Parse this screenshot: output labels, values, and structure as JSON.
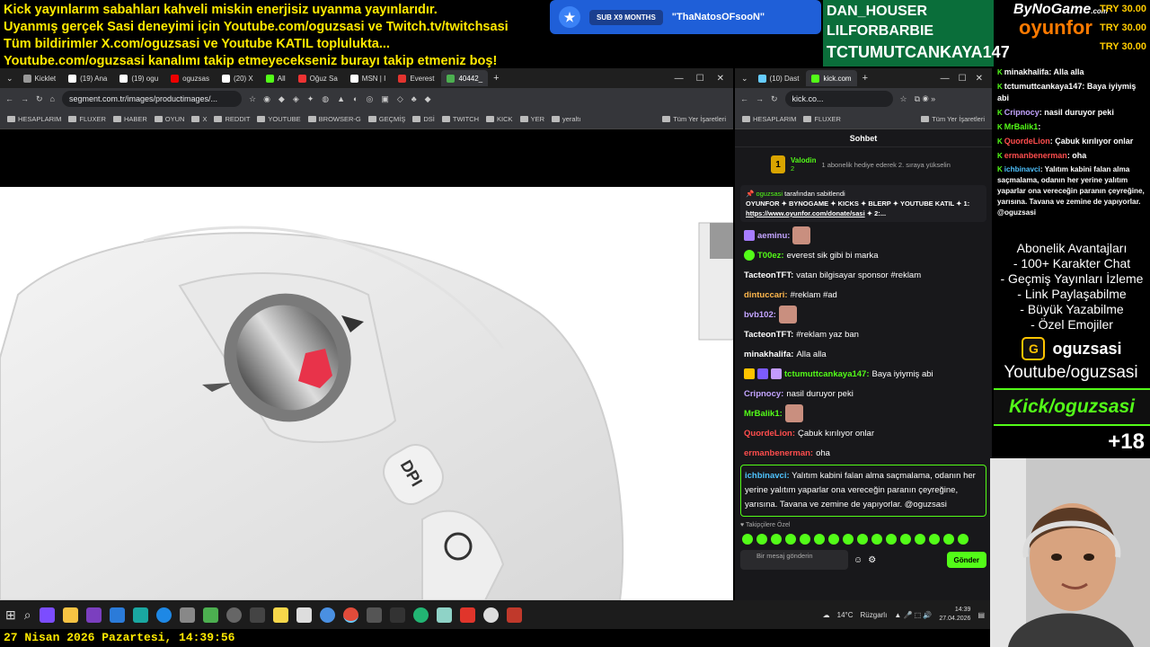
{
  "ticker": {
    "line1": "Kick yayınlarım sabahları kahveli miskin enerjisiz uyanma yayınlarıdır.",
    "line2": "Uyanmış gerçek Sasi deneyimi için Youtube.com/oguzsasi ve Twitch.tv/twitchsasi",
    "line3": "Tüm bildirimler X.com/oguzsasi ve Youtube KATIL toplulukta...",
    "line4": "Youtube.com/oguzsasi kanalımı takip etmeyecekseniz burayı takip etmeniz boş!"
  },
  "sub_alert": {
    "pill": "SUB X9 MONTHS",
    "name": "\"ThaNatosOFsooN\""
  },
  "top_donors": [
    "DAN_HOUSER",
    "LILFORBARBIE",
    "TCTUMUTCANKAYA147"
  ],
  "brand": {
    "top": "ByNoGame",
    "bottom": "oyunfor",
    "com": ".com"
  },
  "tries": [
    "TRY 30.00",
    "TRY 30.00",
    "TRY 30.00"
  ],
  "left_browser": {
    "tabs": [
      "Kicklet",
      "(19) Ana",
      "(19) ogu",
      "oguzsas",
      "(20) X",
      "All",
      "Oğuz Sa",
      "MSN | I",
      "Everest",
      "40442_"
    ],
    "url": "segment.com.tr/images/productimages/...",
    "bookmarks": [
      "HESAPLARIM",
      "FLUXER",
      "HABER",
      "OYUN",
      "X",
      "REDDIT",
      "YOUTUBE",
      "BROWSER-G",
      "GEÇMİŞ",
      "DSİ",
      "TWITCH",
      "KICK",
      "YER",
      "yeraltı",
      "Tüm Yer İşaretleri"
    ],
    "dpi_label": "DPI"
  },
  "right_browser": {
    "tabs": [
      "(10) Dast",
      "kick.com"
    ],
    "url": "kick.co...",
    "bookmarks": [
      "HESAPLARIM",
      "FLUXER",
      "Tüm Yer İşaretleri"
    ],
    "chat_title": "Sohbet",
    "gift_user": "Valodin",
    "gift_count": "2",
    "gift_badge": "1",
    "gift_text": "1 abonelik hediye ederek 2. sıraya yükselin",
    "pinned_by_user": "oguzsasi",
    "pinned_by_text": "tarafından sabitlendi",
    "pinned_text": "OYUNFOR ✦ BYNOGAME ✦ KICKS ✦ BLERP ✦ YOUTUBE KATIL ✦ 1:",
    "pinned_link": "https://www.oyunfor.com/donate/sasi",
    "pinned_suffix": "✦ 2:...",
    "messages": [
      {
        "user": "aeminu:",
        "color": "#c3a4ff",
        "text": ""
      },
      {
        "user": "T00ez:",
        "color": "#53fc18",
        "text": "everest sik gibi bi marka"
      },
      {
        "user": "TacteonTFT:",
        "color": "#ffffff",
        "text": "vatan bilgisayar sponsor #reklam"
      },
      {
        "user": "dintuccari:",
        "color": "#ffb84d",
        "text": "#reklam #ad"
      },
      {
        "user": "bvb102:",
        "color": "#c3a4ff",
        "text": ""
      },
      {
        "user": "TacteonTFT:",
        "color": "#ffffff",
        "text": "#reklam yaz ban"
      },
      {
        "user": "minakhalifa:",
        "color": "#ffffff",
        "text": "Alla alla"
      },
      {
        "user": "tctumuttcankaya147:",
        "color": "#53fc18",
        "text": "Baya iyiymiş abi"
      },
      {
        "user": "Cripnocy:",
        "color": "#c3a4ff",
        "text": "nasil duruyor peki"
      },
      {
        "user": "MrBalik1:",
        "color": "#53fc18",
        "text": ""
      },
      {
        "user": "QuordeLion:",
        "color": "#ff4d4d",
        "text": "Çabuk kırılıyor onlar"
      },
      {
        "user": "ermanbenerman:",
        "color": "#ff4d4d",
        "text": "oha"
      }
    ],
    "highlight_user": "ichbinavci:",
    "highlight_text": "Yalıtım kabini falan alma saçmalama, odanın her yerine yalıtım yaparlar ona vereceğin paranın çeyreğine, yarısına. Tavana ve zemine de yapıyorlar. @oguzsasi",
    "followers_label": "Takipçilere Özel",
    "input_placeholder": "Bir mesaj gönderin",
    "send_label": "Gönder"
  },
  "overlay_chat": [
    {
      "user": "minakhalifa",
      "text": ": Alla alla"
    },
    {
      "user": "tctumuttcankaya147",
      "text": ": Baya iyiymiş abi"
    },
    {
      "user": "Cripnocy",
      "text": ": nasil duruyor peki"
    },
    {
      "user": "MrBalik1",
      "text": ":"
    },
    {
      "user": "QuordeLion",
      "text": ": Çabuk kırılıyor onlar"
    },
    {
      "user": "ermanbenerman",
      "text": ": oha"
    },
    {
      "user": "ichbinavci",
      "text": ": Yalıtım kabini falan alma saçmalama, odanın her yerine yalıtım yaparlar ona vereceğin paranın çeyreğine, yarısına. Tavana ve zemine de yapıyorlar. @oguzsasi"
    }
  ],
  "perks": [
    "Abonelik Avantajları",
    "- 100+ Karakter Chat",
    "- Geçmiş Yayınları İzleme",
    "- Link Paylaşabilme",
    "- Büyük Yazabilme",
    "- Özel Emojiler"
  ],
  "kick_user": "oguzsasi",
  "youtube_line": "Youtube/oguzsasi",
  "kick_banner": "Kick/oguzsasi",
  "age": "+18",
  "taskbar": {
    "weather": "14°C",
    "weather_desc": "Rüzgarlı",
    "time": "14:39",
    "date": "27.04.2026"
  },
  "datebar": "27 Nisan 2026 Pazartesi, 14:39:56"
}
